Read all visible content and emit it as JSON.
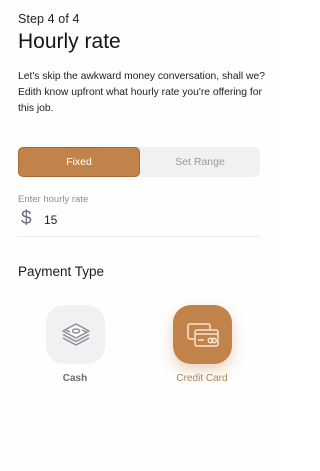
{
  "header": {
    "step": "Step 4 of 4",
    "title": "Hourly rate",
    "description": "Let's skip the awkward money conversation, shall we? Edith know upfront what hourly rate you're offering for this job."
  },
  "rate_type": {
    "options": [
      "Fixed",
      "Set Range"
    ],
    "selected": "Fixed"
  },
  "rate_input": {
    "label": "Enter hourly rate",
    "currency_symbol": "$",
    "value": "15"
  },
  "payment": {
    "section_title": "Payment Type",
    "options": [
      {
        "label": "Cash",
        "icon": "cash-stack-icon",
        "selected": false
      },
      {
        "label": "Credit Card",
        "icon": "credit-card-icon",
        "selected": true
      }
    ]
  },
  "colors": {
    "accent": "#c18349",
    "muted_tile": "#f1f1f3"
  }
}
